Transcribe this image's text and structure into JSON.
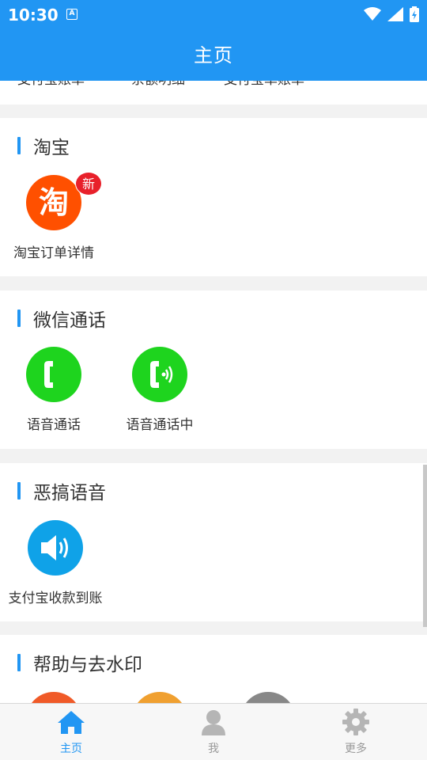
{
  "status_bar": {
    "time": "10:30",
    "notif_letter": "A"
  },
  "app_bar": {
    "title": "主页"
  },
  "top_partial": {
    "labels": [
      "支付宝账单",
      "余额明细",
      "支付宝单账单"
    ]
  },
  "sections": [
    {
      "title": "淘宝",
      "items": [
        {
          "label": "淘宝订单详情",
          "icon": "taobao-icon",
          "icon_text": "淘",
          "color": "#ff5000",
          "badge": "新"
        }
      ]
    },
    {
      "title": "微信通话",
      "items": [
        {
          "label": "语音通话",
          "icon": "phone-icon",
          "color": "#1ed41e"
        },
        {
          "label": "语音通话中",
          "icon": "phone-calling-icon",
          "color": "#1ed41e"
        }
      ]
    },
    {
      "title": "恶搞语音",
      "items": [
        {
          "label": "支付宝收款到账",
          "icon": "speaker-icon",
          "color": "#0fa2e8"
        }
      ]
    },
    {
      "title": "帮助与去水印",
      "items": [
        {
          "icon": "help-icon",
          "color": "#f05a28"
        },
        {
          "icon": "watermark-icon",
          "color": "#f0a030"
        },
        {
          "icon": "more-icon",
          "color": "#888888"
        }
      ]
    }
  ],
  "bottom_nav": {
    "tabs": [
      {
        "label": "主页",
        "icon": "home-icon"
      },
      {
        "label": "我",
        "icon": "person-icon"
      },
      {
        "label": "更多",
        "icon": "gear-icon"
      }
    ],
    "active_color": "#2196f3",
    "inactive_color": "#999999"
  }
}
